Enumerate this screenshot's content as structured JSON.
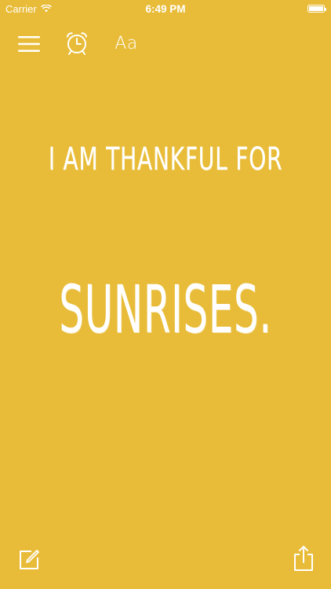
{
  "status_bar": {
    "carrier": "Carrier",
    "time": "6:49 PM",
    "battery_level": 1.0
  },
  "toolbar": {
    "menu_icon": "hamburger-menu-icon",
    "alarm_icon": "alarm-clock-icon",
    "font_label": "Aa"
  },
  "content": {
    "prompt": "I AM THANKFUL FOR",
    "answer": "SUNRISES."
  },
  "bottom_bar": {
    "compose_icon": "compose-icon",
    "share_icon": "share-icon"
  },
  "colors": {
    "background": "#E8BC38",
    "foreground": "#FFFFFF"
  }
}
